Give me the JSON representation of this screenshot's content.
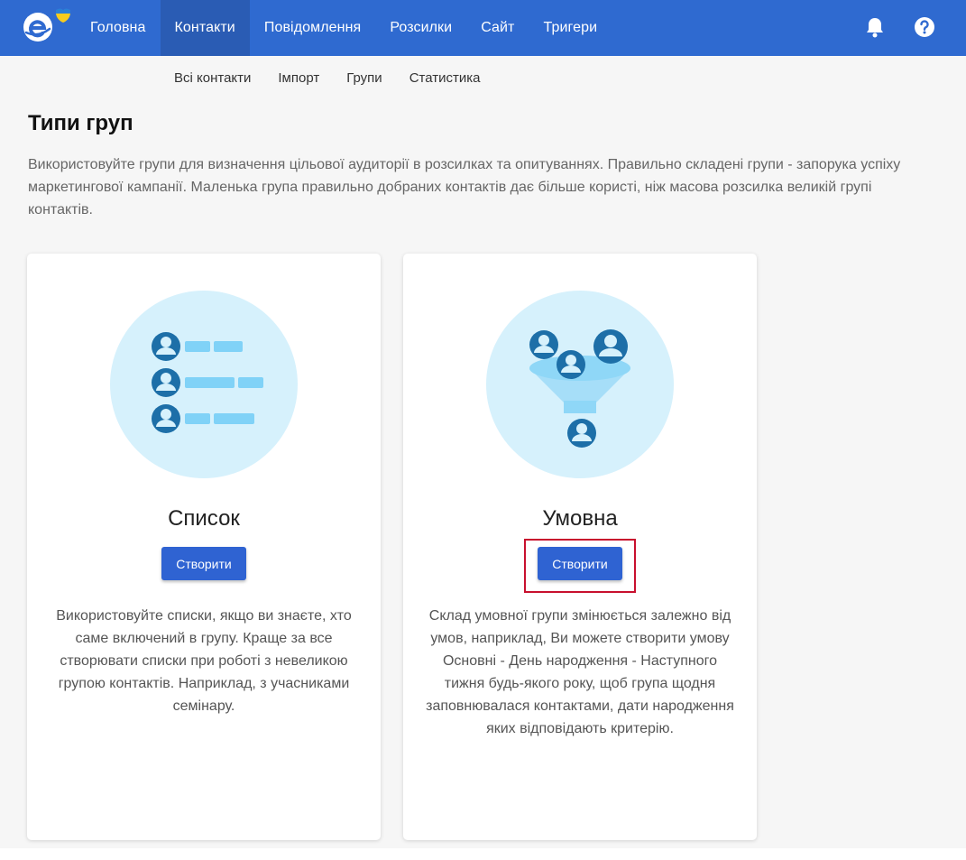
{
  "header": {
    "nav": [
      {
        "label": "Головна"
      },
      {
        "label": "Контакти"
      },
      {
        "label": "Повідомлення"
      },
      {
        "label": "Розсилки"
      },
      {
        "label": "Сайт"
      },
      {
        "label": "Тригери"
      }
    ],
    "active_nav": "Контакти",
    "icons": [
      "bell-icon",
      "help-icon"
    ]
  },
  "subnav": [
    {
      "label": "Всі контакти"
    },
    {
      "label": "Імпорт"
    },
    {
      "label": "Групи"
    },
    {
      "label": "Статистика"
    }
  ],
  "page": {
    "title": "Типи груп",
    "description": "Використовуйте групи для визначення цільової аудиторії в розсилках та опитуваннях. Правильно складені групи - запорука успіху маркетингової кампанії. Маленька група правильно добраних контактів дає більше користі, ніж масова розсилка великій групі контактів."
  },
  "cards": [
    {
      "title": "Список",
      "button": "Створити",
      "text": "Використовуйте списки, якщо ви знаєте, хто саме включений в групу. Краще за все створювати списки при роботі з невеликою групою контактів. Наприклад, з учасниками семінару.",
      "icon": "list-group-illustration"
    },
    {
      "title": "Умовна",
      "button": "Створити",
      "text": "Склад умовної групи змінюється залежно від умов, наприклад, Ви можете створити умову Основні - День народження - Наступного тижня будь-якого року, щоб група щодня заповнювалася контактами, дати народження яких відповідають критерію.",
      "icon": "funnel-group-illustration"
    }
  ],
  "colors": {
    "header": "#2f6ad0",
    "accent_button": "#2f63d2",
    "highlight": "#c8102e",
    "illustration_bg": "#d6f1fc",
    "avatar": "#1d6fa8",
    "bar": "#80d2f7"
  }
}
